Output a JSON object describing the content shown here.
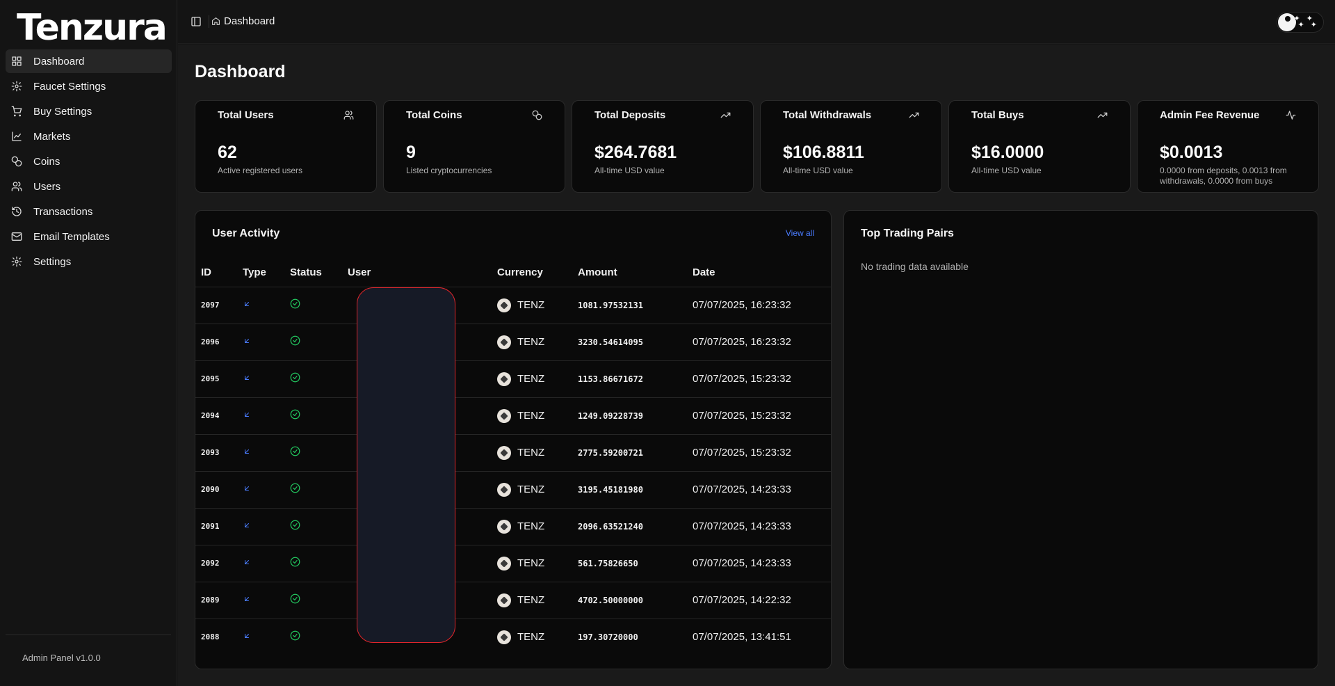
{
  "app": {
    "logo": "Tenzura",
    "version": "Admin Panel v1.0.0"
  },
  "sidebar": {
    "items": [
      {
        "label": "Dashboard",
        "icon": "grid-icon",
        "active": true
      },
      {
        "label": "Faucet Settings",
        "icon": "gear-icon"
      },
      {
        "label": "Buy Settings",
        "icon": "cart-icon"
      },
      {
        "label": "Markets",
        "icon": "chart-line-icon"
      },
      {
        "label": "Coins",
        "icon": "coins-icon"
      },
      {
        "label": "Users",
        "icon": "users-icon"
      },
      {
        "label": "Transactions",
        "icon": "history-icon"
      },
      {
        "label": "Email Templates",
        "icon": "mail-icon"
      },
      {
        "label": "Settings",
        "icon": "gear-icon"
      }
    ]
  },
  "header": {
    "breadcrumb": "Dashboard"
  },
  "page": {
    "title": "Dashboard"
  },
  "stats": [
    {
      "label": "Total Users",
      "value": "62",
      "sub": "Active registered users",
      "icon": "users-icon"
    },
    {
      "label": "Total Coins",
      "value": "9",
      "sub": "Listed cryptocurrencies",
      "icon": "coins-icon"
    },
    {
      "label": "Total Deposits",
      "value": "$264.7681",
      "sub": "All-time USD value",
      "icon": "trending-up-icon"
    },
    {
      "label": "Total Withdrawals",
      "value": "$106.8811",
      "sub": "All-time USD value",
      "icon": "trending-up-icon"
    },
    {
      "label": "Total Buys",
      "value": "$16.0000",
      "sub": "All-time USD value",
      "icon": "trending-up-icon"
    },
    {
      "label": "Admin Fee Revenue",
      "value": "$0.0013",
      "sub": "0.0000 from deposits, 0.0013 from withdrawals, 0.0000 from buys",
      "icon": "activity-icon"
    }
  ],
  "activity": {
    "title": "User Activity",
    "view_all": "View all",
    "columns": [
      "ID",
      "Type",
      "Status",
      "User",
      "Currency",
      "Amount",
      "Date"
    ],
    "rows": [
      {
        "id": "2097",
        "currency": "TENZ",
        "amount": "1081.97532131",
        "date": "07/07/2025, 16:23:32"
      },
      {
        "id": "2096",
        "currency": "TENZ",
        "amount": "3230.54614095",
        "date": "07/07/2025, 16:23:32"
      },
      {
        "id": "2095",
        "currency": "TENZ",
        "amount": "1153.86671672",
        "date": "07/07/2025, 15:23:32"
      },
      {
        "id": "2094",
        "currency": "TENZ",
        "amount": "1249.09228739",
        "date": "07/07/2025, 15:23:32"
      },
      {
        "id": "2093",
        "currency": "TENZ",
        "amount": "2775.59200721",
        "date": "07/07/2025, 15:23:32"
      },
      {
        "id": "2090",
        "currency": "TENZ",
        "amount": "3195.45181980",
        "date": "07/07/2025, 14:23:33"
      },
      {
        "id": "2091",
        "currency": "TENZ",
        "amount": "2096.63521240",
        "date": "07/07/2025, 14:23:33"
      },
      {
        "id": "2092",
        "currency": "TENZ",
        "amount": "561.75826650",
        "date": "07/07/2025, 14:23:33"
      },
      {
        "id": "2089",
        "currency": "TENZ",
        "amount": "4702.50000000",
        "date": "07/07/2025, 14:22:32"
      },
      {
        "id": "2088",
        "currency": "TENZ",
        "amount": "197.30720000",
        "date": "07/07/2025, 13:41:51"
      }
    ]
  },
  "pairs": {
    "title": "Top Trading Pairs",
    "empty": "No trading data available"
  },
  "colors": {
    "accent": "#4a7cff",
    "success": "#22c55e",
    "redaction_border": "#e0252b"
  }
}
